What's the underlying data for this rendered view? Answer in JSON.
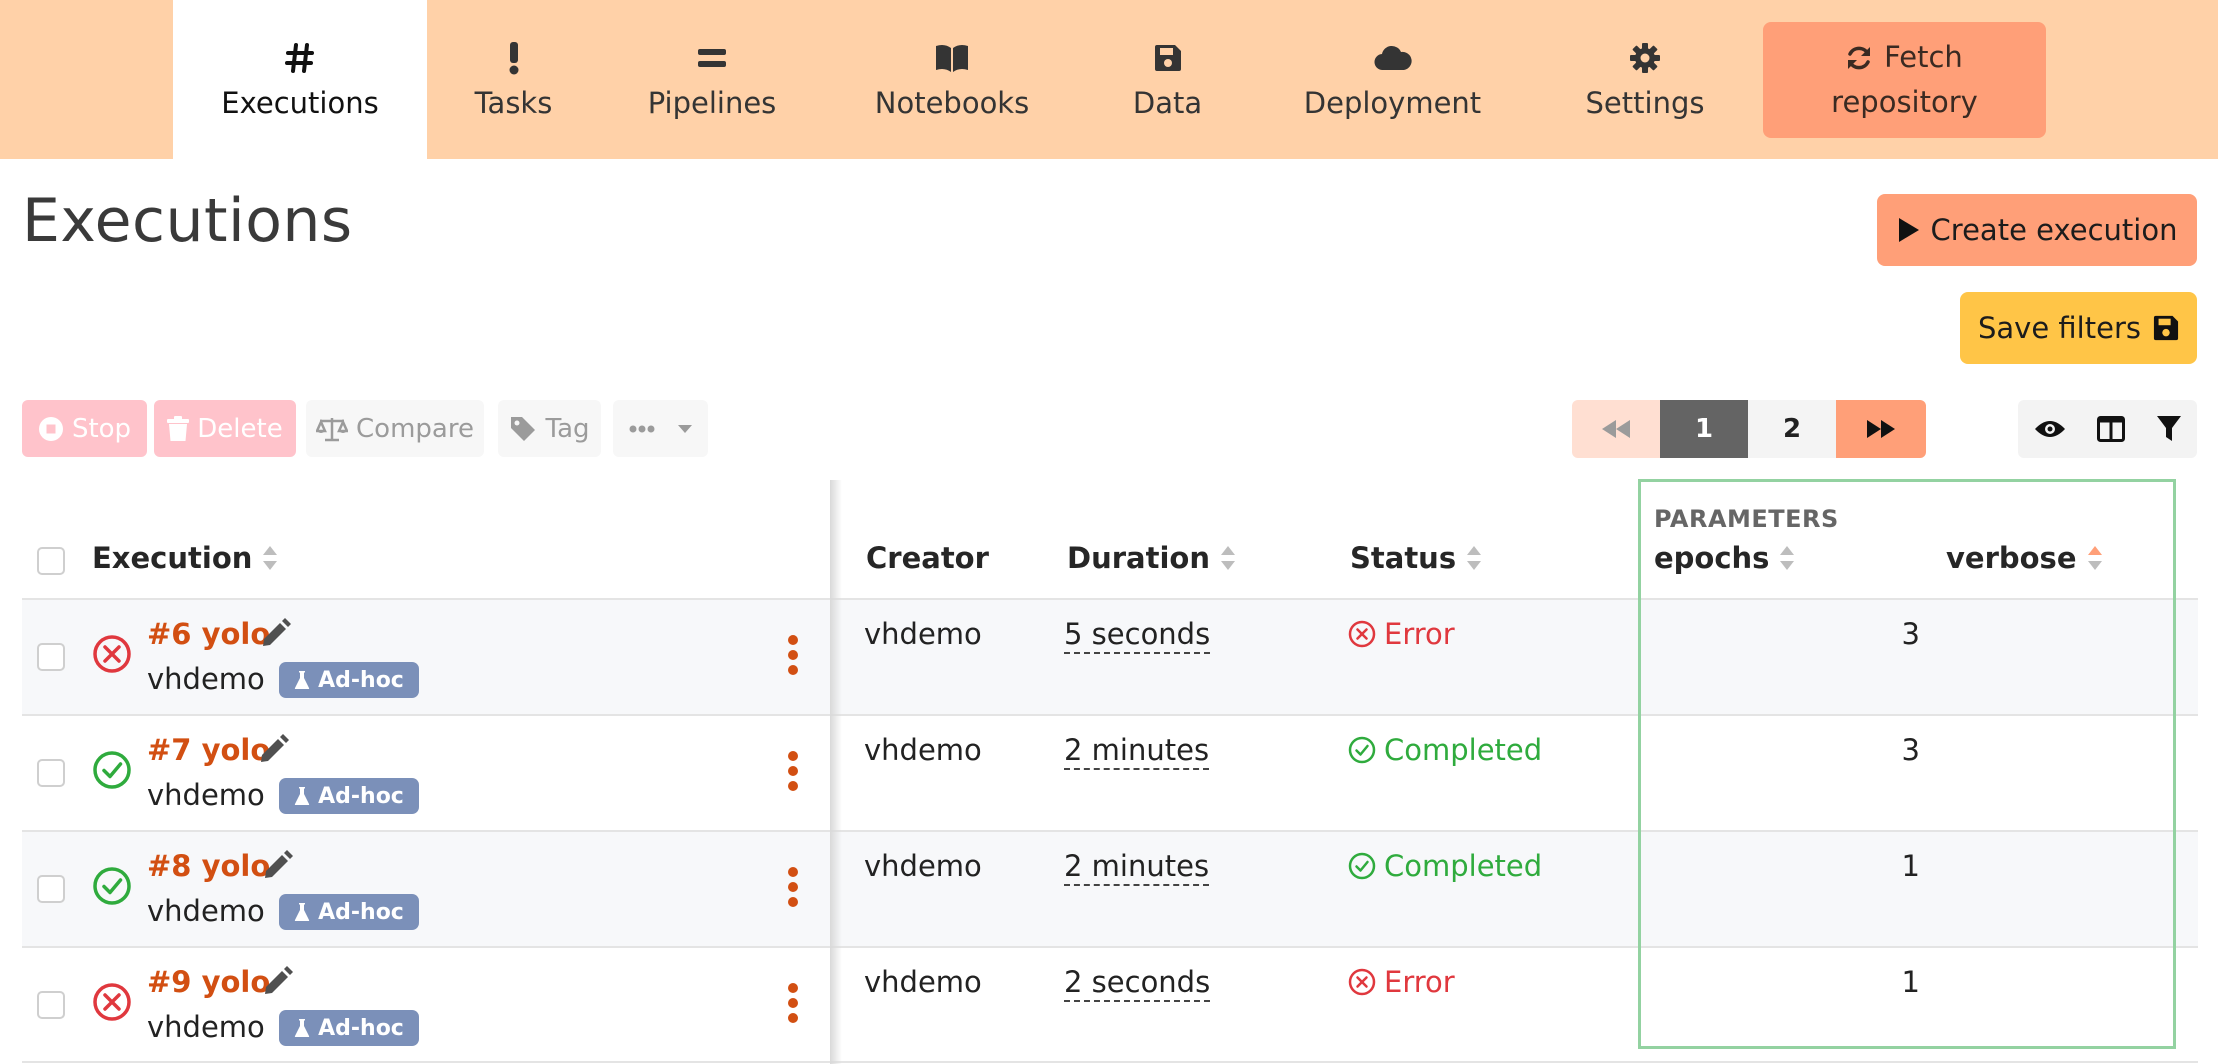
{
  "nav": {
    "tabs": [
      {
        "key": "executions",
        "label": "Executions",
        "icon": "hash-icon",
        "active": true
      },
      {
        "key": "tasks",
        "label": "Tasks",
        "icon": "exclamation-icon"
      },
      {
        "key": "pipelines",
        "label": "Pipelines",
        "icon": "equals-icon"
      },
      {
        "key": "notebooks",
        "label": "Notebooks",
        "icon": "book-icon"
      },
      {
        "key": "data",
        "label": "Data",
        "icon": "floppy-disk-icon"
      },
      {
        "key": "deployment",
        "label": "Deployment",
        "icon": "cloud-icon"
      },
      {
        "key": "settings",
        "label": "Settings",
        "icon": "gear-icon"
      }
    ],
    "fetch": {
      "line1": "Fetch",
      "line2": "repository",
      "icon": "sync-icon"
    }
  },
  "page": {
    "title": "Executions",
    "create_label": "Create execution",
    "save_filters_label": "Save filters"
  },
  "toolbar": {
    "stop": "Stop",
    "delete": "Delete",
    "compare": "Compare",
    "tag": "Tag"
  },
  "pagination": {
    "pages": [
      "1",
      "2"
    ],
    "current": "1"
  },
  "table": {
    "columns": {
      "execution": "Execution",
      "creator": "Creator",
      "duration": "Duration",
      "status": "Status",
      "params_group": "PARAMETERS",
      "epochs": "epochs",
      "verbose": "verbose"
    },
    "badge_label": "Ad-hoc",
    "rows": [
      {
        "name": "#6 yolo",
        "user": "vhdemo",
        "creator": "vhdemo",
        "duration": "5 seconds",
        "status": "Error",
        "status_kind": "error",
        "epochs": "3"
      },
      {
        "name": "#7 yolo",
        "user": "vhdemo",
        "creator": "vhdemo",
        "duration": "2 minutes",
        "status": "Completed",
        "status_kind": "ok",
        "epochs": "3"
      },
      {
        "name": "#8 yolo",
        "user": "vhdemo",
        "creator": "vhdemo",
        "duration": "2 minutes",
        "status": "Completed",
        "status_kind": "ok",
        "epochs": "1"
      },
      {
        "name": "#9 yolo",
        "user": "vhdemo",
        "creator": "vhdemo",
        "duration": "2 seconds",
        "status": "Error",
        "status_kind": "error",
        "epochs": "1"
      }
    ]
  },
  "colors": {
    "nav_bg": "#ffd1a8",
    "accent": "#ff9f78",
    "save_btn": "#ffc547",
    "link": "#d24f12",
    "error": "#e0383e",
    "success": "#2fab3d",
    "badge": "#7b90b9"
  }
}
